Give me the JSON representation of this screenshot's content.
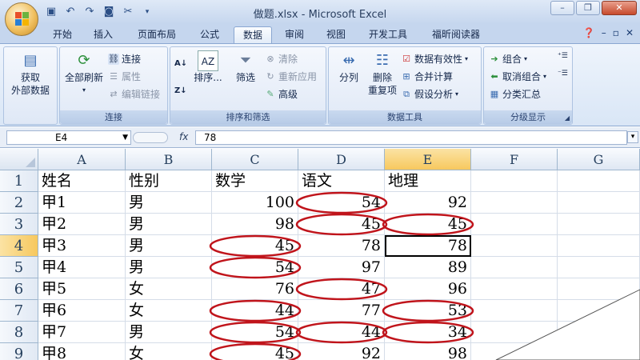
{
  "window": {
    "title": "做题.xlsx - Microsoft Excel",
    "minimize": "–",
    "restore": "❐",
    "close": "✕"
  },
  "qat": [
    "save-icon",
    "undo-icon",
    "redo-icon",
    "camera-icon",
    "tools-icon"
  ],
  "tabs": [
    "开始",
    "插入",
    "页面布局",
    "公式",
    "数据",
    "审阅",
    "视图",
    "开发工具",
    "福昕阅读器"
  ],
  "active_tab": "数据",
  "ribbon": {
    "get_external_data": "获取\n外部数据",
    "get_external_data_l1": "获取",
    "get_external_data_l2": "外部数据",
    "refresh_all": "全部刷新",
    "connections_group": {
      "label": "连接",
      "items": [
        "连接",
        "属性",
        "编辑链接"
      ]
    },
    "sort_filter_group": {
      "label": "排序和筛选",
      "sort": "排序...",
      "filter": "筛选",
      "clear": "清除",
      "reapply": "重新应用",
      "advanced": "高级"
    },
    "data_tools_group": {
      "label": "数据工具",
      "text_to_columns": "分列",
      "remove_dup_l1": "删除",
      "remove_dup_l2": "重复项",
      "validation": "数据有效性",
      "consolidate": "合并计算",
      "whatif": "假设分析"
    },
    "outline_group": {
      "label": "分级显示",
      "group": "组合",
      "ungroup": "取消组合",
      "subtotal": "分类汇总"
    }
  },
  "formula_bar": {
    "name_box": "E4",
    "fx": "fx",
    "value": "78"
  },
  "columns": [
    "A",
    "B",
    "C",
    "D",
    "E",
    "F",
    "G"
  ],
  "rows": [
    "1",
    "2",
    "3",
    "4",
    "5",
    "6",
    "7",
    "8",
    "9"
  ],
  "selected_cell": {
    "column": "E",
    "row": "4"
  },
  "table": [
    [
      "姓名",
      "性别",
      "数学",
      "语文",
      "地理"
    ],
    [
      "甲1",
      "男",
      "100",
      "54",
      "92"
    ],
    [
      "甲2",
      "男",
      "98",
      "45",
      "45"
    ],
    [
      "甲3",
      "男",
      "45",
      "78",
      "78"
    ],
    [
      "甲4",
      "男",
      "54",
      "97",
      "89"
    ],
    [
      "甲5",
      "女",
      "76",
      "47",
      "96"
    ],
    [
      "甲6",
      "女",
      "44",
      "77",
      "53"
    ],
    [
      "甲7",
      "男",
      "54",
      "44",
      "34"
    ],
    [
      "甲8",
      "女",
      "45",
      "92",
      "98"
    ]
  ],
  "circled_cells": [
    "D2",
    "D3",
    "E3",
    "C4",
    "C5",
    "D6",
    "C7",
    "E7",
    "C8",
    "D8",
    "E8",
    "C9"
  ],
  "annotation_color": "#c0141b"
}
